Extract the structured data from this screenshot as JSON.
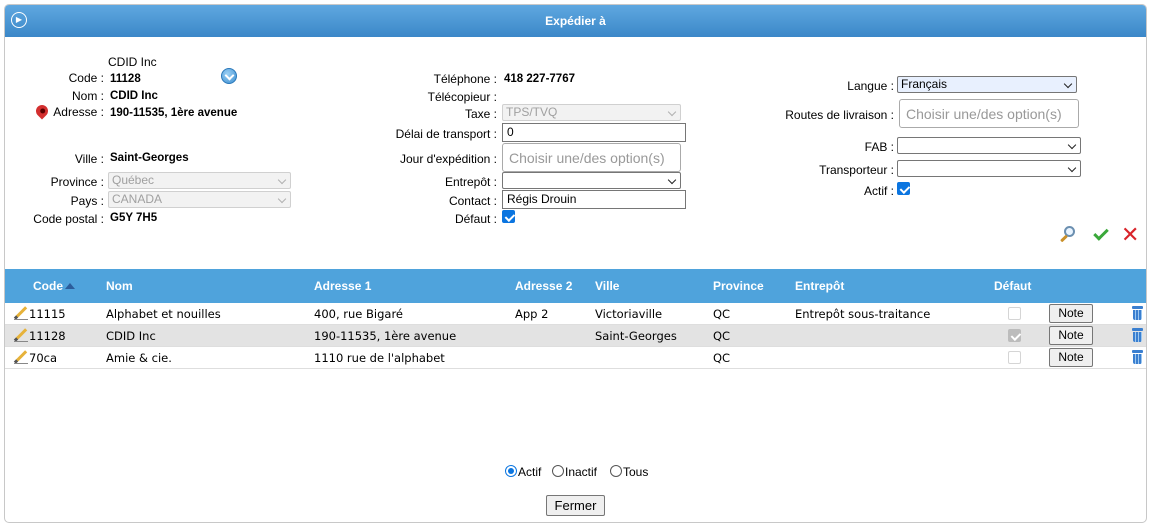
{
  "header": {
    "title": "Expédier à"
  },
  "left": {
    "company_name": "CDID Inc",
    "code_label": "Code :",
    "code_value": "11128",
    "nom_label": "Nom :",
    "nom_value": "CDID Inc",
    "adresse_label": "Adresse :",
    "adresse_value": "190-11535, 1ère avenue",
    "ville_label": "Ville :",
    "ville_value": "Saint-Georges",
    "province_label": "Province :",
    "province_value": "Québec",
    "pays_label": "Pays :",
    "pays_value": "CANADA",
    "code_postal_label": "Code postal :",
    "code_postal_value": "G5Y 7H5"
  },
  "middle": {
    "telephone_label": "Téléphone :",
    "telephone_value": "418 227-7767",
    "telecopieur_label": "Télécopieur :",
    "taxe_label": "Taxe :",
    "taxe_value": "TPS/TVQ",
    "delai_label": "Délai de transport :",
    "delai_value": "0",
    "jour_label": "Jour d'expédition :",
    "jour_placeholder": "Choisir une/des option(s)",
    "entrepot_label": "Entrepôt :",
    "entrepot_value": "",
    "contact_label": "Contact :",
    "contact_value": "Régis Drouin",
    "defaut_label": "Défaut :"
  },
  "right": {
    "langue_label": "Langue :",
    "langue_value": "Français",
    "routes_label": "Routes de livraison :",
    "routes_placeholder": "Choisir une/des option(s)",
    "fab_label": "FAB :",
    "fab_value": "",
    "transporteur_label": "Transporteur :",
    "transporteur_value": "",
    "actif_label": "Actif :"
  },
  "actions": {
    "search_icon": "magnifier-icon",
    "save_icon": "green-check-icon",
    "cancel_icon": "red-x-icon"
  },
  "table": {
    "headers": [
      "Code",
      "Nom",
      "Adresse 1",
      "Adresse 2",
      "Ville",
      "Province",
      "Entrepôt",
      "Défaut"
    ],
    "rows": [
      {
        "code": "11115",
        "nom": "Alphabet et nouilles",
        "adresse1": "400, rue Bigaré",
        "adresse2": "App 2",
        "ville": "Victoriaville",
        "province": "QC",
        "entrepot": "Entrepôt sous-traitance",
        "defaut": false
      },
      {
        "code": "11128",
        "nom": "CDID Inc",
        "adresse1": "190-11535, 1ère avenue",
        "adresse2": "",
        "ville": "Saint-Georges",
        "province": "QC",
        "entrepot": "",
        "defaut": true
      },
      {
        "code": "70ca",
        "nom": "Amie & cie.",
        "adresse1": "1110 rue de l'alphabet",
        "adresse2": "",
        "ville": "",
        "province": "QC",
        "entrepot": "",
        "defaut": false
      }
    ],
    "note_label": "Note"
  },
  "filter": {
    "actif": "Actif",
    "inactif": "Inactif",
    "tous": "Tous",
    "selected": "Actif"
  },
  "footer": {
    "fermer_label": "Fermer"
  }
}
